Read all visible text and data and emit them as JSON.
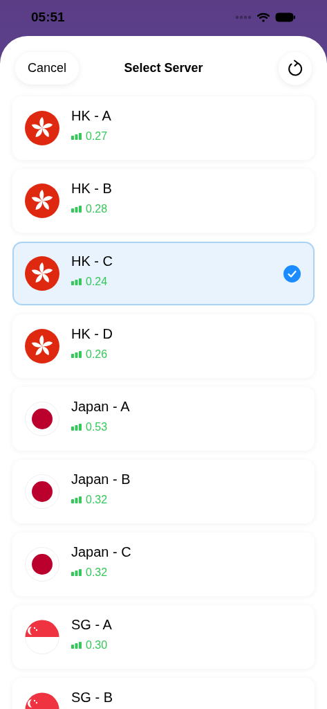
{
  "status_bar": {
    "time": "05:51"
  },
  "header": {
    "cancel": "Cancel",
    "title": "Select Server"
  },
  "servers": [
    {
      "name": "HK - A",
      "latency": "0.27",
      "kind": "hk",
      "selected": false
    },
    {
      "name": "HK - B",
      "latency": "0.28",
      "kind": "hk",
      "selected": false
    },
    {
      "name": "HK - C",
      "latency": "0.24",
      "kind": "hk",
      "selected": true
    },
    {
      "name": "HK - D",
      "latency": "0.26",
      "kind": "hk",
      "selected": false
    },
    {
      "name": "Japan - A",
      "latency": "0.53",
      "kind": "jp",
      "selected": false
    },
    {
      "name": "Japan - B",
      "latency": "0.32",
      "kind": "jp",
      "selected": false
    },
    {
      "name": "Japan - C",
      "latency": "0.32",
      "kind": "jp",
      "selected": false
    },
    {
      "name": "SG - A",
      "latency": "0.30",
      "kind": "sg",
      "selected": false
    },
    {
      "name": "SG - B",
      "kind": "sg",
      "selected": false
    }
  ]
}
